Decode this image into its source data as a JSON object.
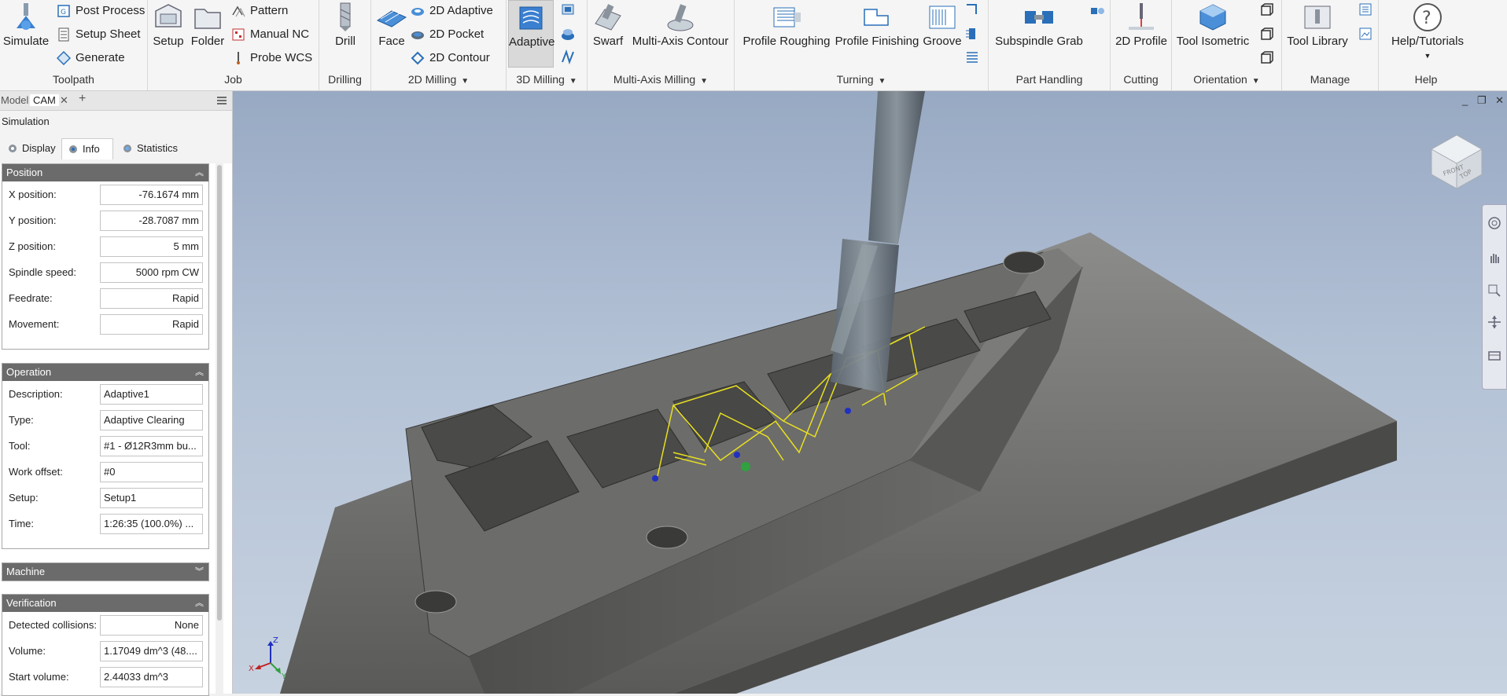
{
  "ribbon": {
    "toolpath": {
      "label": "Toolpath",
      "simulate": "Simulate",
      "post_process": "Post Process",
      "setup_sheet": "Setup Sheet",
      "generate": "Generate"
    },
    "job": {
      "label": "Job",
      "setup": "Setup",
      "folder": "Folder",
      "pattern": "Pattern",
      "manual_nc": "Manual NC",
      "probe_wcs": "Probe WCS"
    },
    "drilling": {
      "label": "Drilling",
      "drill": "Drill"
    },
    "milling2d": {
      "label": "2D Milling",
      "face": "Face",
      "adaptive_2d": "2D Adaptive",
      "pocket_2d": "2D Pocket",
      "contour_2d": "2D Contour"
    },
    "milling3d": {
      "label": "3D Milling",
      "adaptive": "Adaptive"
    },
    "multiaxis": {
      "label": "Multi-Axis Milling",
      "swarf": "Swarf",
      "contour": "Multi-Axis Contour"
    },
    "turning": {
      "label": "Turning",
      "profile_roughing": "Profile Roughing",
      "profile_finishing": "Profile Finishing",
      "groove": "Groove"
    },
    "part_handling": {
      "label": "Part Handling",
      "subspindle_grab": "Subspindle Grab"
    },
    "cutting": {
      "label": "Cutting",
      "profile_2d": "2D Profile"
    },
    "orientation": {
      "label": "Orientation",
      "tool_isometric": "Tool Isometric"
    },
    "manage": {
      "label": "Manage",
      "tool_library": "Tool Library"
    },
    "help": {
      "label": "Help",
      "help_tutorials": "Help/Tutorials"
    }
  },
  "browser_tabs": {
    "model": "Model",
    "cam": "CAM",
    "close": "✕",
    "add": "+"
  },
  "simulation": {
    "title": "Simulation",
    "tabs": {
      "display": "Display",
      "info": "Info",
      "statistics": "Statistics"
    },
    "position": {
      "header": "Position",
      "rows": [
        {
          "label": "X position:",
          "value": "-76.1674 mm"
        },
        {
          "label": "Y position:",
          "value": "-28.7087 mm"
        },
        {
          "label": "Z position:",
          "value": "5 mm"
        },
        {
          "label": "Spindle speed:",
          "value": "5000 rpm CW"
        },
        {
          "label": "Feedrate:",
          "value": "Rapid"
        },
        {
          "label": "Movement:",
          "value": "Rapid"
        }
      ]
    },
    "operation": {
      "header": "Operation",
      "rows": [
        {
          "label": "Description:",
          "value": "Adaptive1"
        },
        {
          "label": "Type:",
          "value": "Adaptive Clearing"
        },
        {
          "label": "Tool:",
          "value": "#1 - Ø12R3mm bu..."
        },
        {
          "label": "Work offset:",
          "value": "#0"
        },
        {
          "label": "Setup:",
          "value": "Setup1"
        },
        {
          "label": "Time:",
          "value": "1:26:35 (100.0%) ..."
        }
      ]
    },
    "machine": {
      "header": "Machine"
    },
    "verification": {
      "header": "Verification",
      "rows": [
        {
          "label": "Detected collisions:",
          "value": "None"
        },
        {
          "label": "Volume:",
          "value": "1.17049 dm^3 (48...."
        },
        {
          "label": "Start volume:",
          "value": "2.44033 dm^3"
        }
      ]
    }
  },
  "viewport": {
    "viewcube": {
      "face_front": "FRONT",
      "face_top": "TOP"
    },
    "triad": {
      "x": "X",
      "y": "Y",
      "z": "Z"
    },
    "window_controls": {
      "minimize": "_",
      "restore": "❐",
      "close": "✕"
    }
  },
  "colors": {
    "accent_blue": "#2a6fb8",
    "toolpath_yellow": "#e8e020",
    "panel_header": "#6b6b6b",
    "part_metal": "#6e6e6c"
  }
}
